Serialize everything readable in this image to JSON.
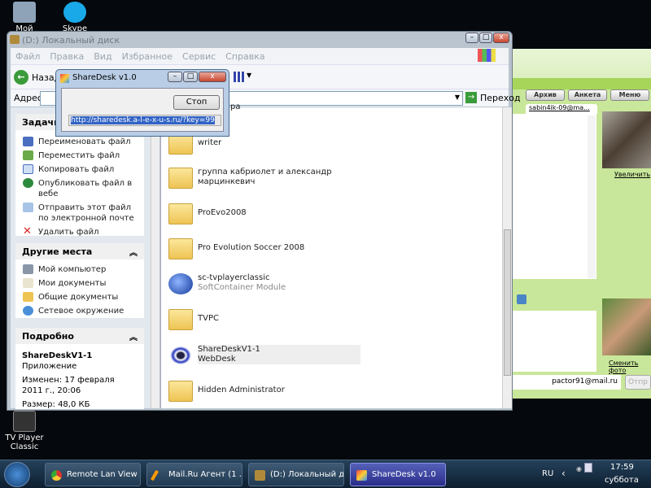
{
  "desktop": {
    "icons": [
      {
        "label": "Мой"
      },
      {
        "label": "Skype"
      },
      {
        "label": "TV Player Classic"
      }
    ]
  },
  "agent": {
    "buttons": [
      "Архив",
      "Анкета",
      "Меню"
    ],
    "chat_tab": "sabin4ik-09@ma...",
    "zoom_link": "Увеличить",
    "change_photo": "Сменить фото",
    "own_email": "pactor91@mail.ru",
    "send_button": "Отпр"
  },
  "explorer": {
    "title": "(D:) Локальный диск",
    "menu": [
      "Файл",
      "Правка",
      "Вид",
      "Избранное",
      "Сервис",
      "Справка"
    ],
    "back_label": "Назад",
    "address_label": "Адрес:",
    "address_value": "D",
    "go_label": "Переход",
    "tasks": {
      "title": "Задачи д",
      "items": [
        "Переименовать файл",
        "Переместить файл",
        "Копировать файл",
        "Опубликовать файл в вебе",
        "Отправить этот файл по электронной почте",
        "Удалить файл"
      ]
    },
    "other_places": {
      "title": "Другие места",
      "items": [
        "Мой компьютер",
        "Мои документы",
        "Общие документы",
        "Сетевое окружение"
      ]
    },
    "details": {
      "title": "Подробно",
      "name": "ShareDeskV1-1",
      "type": "Приложение",
      "modified": "Изменен: 17 февраля 2011 г., 20:06",
      "size": "Размер: 48,0 КБ"
    },
    "files": [
      {
        "name": "ра",
        "sub": ""
      },
      {
        "name": "writer",
        "sub": ""
      },
      {
        "name": "группа кабриолет и александр марцинкевич",
        "sub": ""
      },
      {
        "name": "ProEvo2008",
        "sub": ""
      },
      {
        "name": "Pro Evolution Soccer 2008",
        "sub": ""
      },
      {
        "name": "sc-tvplayerclassic",
        "sub": "SoftContainer Module"
      },
      {
        "name": "TVPC",
        "sub": ""
      },
      {
        "name": "ShareDeskV1-1",
        "sub": "WebDesk"
      },
      {
        "name": "Hidden Administrator",
        "sub": ""
      }
    ]
  },
  "sharedesk": {
    "title": "ShareDesk v1.0",
    "stop_label": "Стоп",
    "url": "http://sharedesk.a-l-e-x-u-s.ru/?key=99"
  },
  "taskbar": {
    "items": [
      "Remote Lan View ...",
      "Mail.Ru Агент (1 ...",
      "(D:) Локальный д...",
      "ShareDesk v1.0"
    ],
    "lang": "RU",
    "time": "17:59",
    "day": "суббота"
  }
}
